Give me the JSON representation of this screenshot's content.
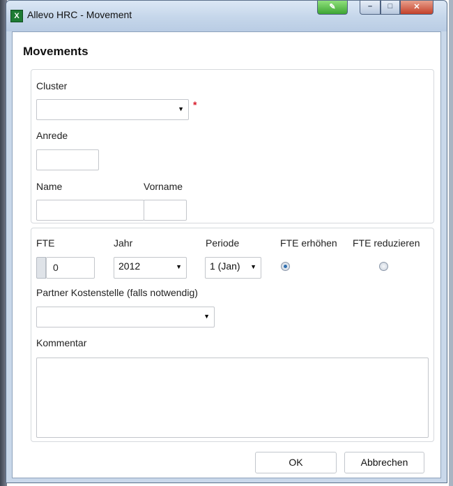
{
  "window": {
    "title": "Allevo HRC - Movement",
    "app_icon_glyph": "X",
    "controls": [
      "customize-icon",
      "minimize-icon",
      "maximize-icon",
      "close-icon"
    ]
  },
  "dialog": {
    "heading": "Movements",
    "person": {
      "cluster_label": "Cluster",
      "cluster_value": "",
      "cluster_required_mark": "*",
      "anrede_label": "Anrede",
      "anrede_value": "",
      "name_label": "Name",
      "name_value": "",
      "vorname_label": "Vorname",
      "vorname_value": ""
    },
    "movement": {
      "fte_label": "FTE",
      "fte_value": "0",
      "jahr_label": "Jahr",
      "jahr_value": "2012",
      "periode_label": "Periode",
      "periode_value": "1 (Jan)",
      "fte_erhoehen_label": "FTE erhöhen",
      "fte_erhoehen_selected": true,
      "fte_reduzieren_label": "FTE reduzieren",
      "fte_reduzieren_selected": false,
      "partner_label": "Partner Kostenstelle (falls notwendig)",
      "partner_value": "",
      "kommentar_label": "Kommentar",
      "kommentar_value": ""
    },
    "buttons": {
      "ok": "OK",
      "cancel": "Abbrechen"
    }
  },
  "colors": {
    "required": "#d81b2a",
    "radio_selected": "#2f6fb0",
    "window_frame": "#c9d8ea"
  }
}
